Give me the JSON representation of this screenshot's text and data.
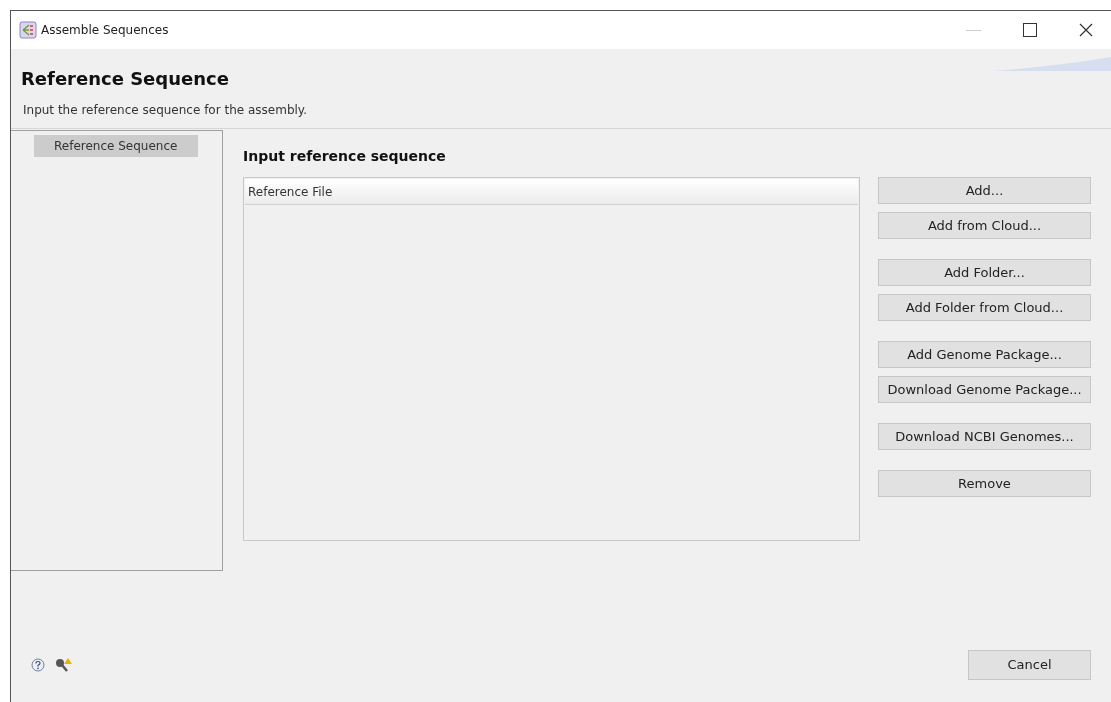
{
  "window": {
    "title": "Assemble Sequences"
  },
  "header": {
    "title": "Reference Sequence",
    "description": "Input the reference sequence for the assembly."
  },
  "sidebar": {
    "items": [
      {
        "label": "Reference Sequence",
        "selected": true
      }
    ]
  },
  "main": {
    "heading": "Input reference sequence",
    "table": {
      "columns": [
        "Reference File"
      ]
    },
    "button_groups": [
      [
        "Add...",
        "Add from Cloud..."
      ],
      [
        "Add Folder...",
        "Add Folder from Cloud..."
      ],
      [
        "Add Genome Package...",
        "Download Genome Package..."
      ],
      [
        "Download NCBI Genomes..."
      ],
      [
        "Remove"
      ]
    ]
  },
  "footer": {
    "buttons": [
      "Cancel"
    ]
  }
}
